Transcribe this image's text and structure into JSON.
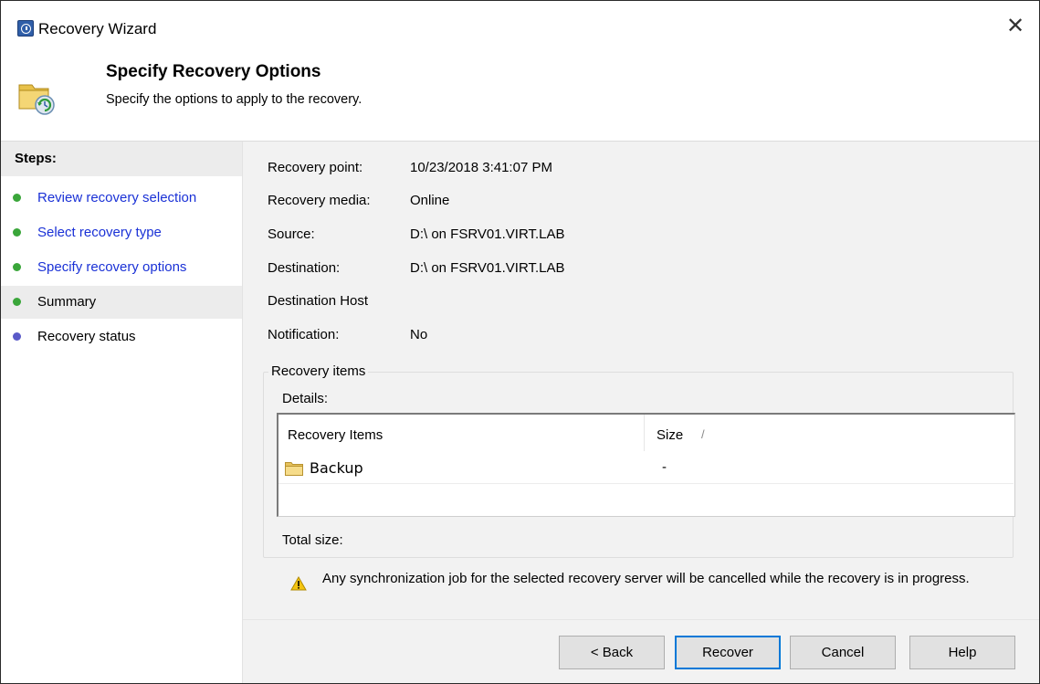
{
  "window": {
    "title": "Recovery Wizard",
    "close_glyph": "✕"
  },
  "header": {
    "title": "Specify Recovery Options",
    "subtitle": "Specify the options to apply to the recovery.",
    "icon": "folder-recovery-icon"
  },
  "steps": {
    "heading": "Steps:",
    "items": [
      {
        "label": "Review recovery selection",
        "state": "completed",
        "dot_color": "#3aa63a",
        "is_link": true
      },
      {
        "label": "Select recovery type",
        "state": "completed",
        "dot_color": "#3aa63a",
        "is_link": true
      },
      {
        "label": "Specify recovery options",
        "state": "completed",
        "dot_color": "#3aa63a",
        "is_link": true
      },
      {
        "label": "Summary",
        "state": "current",
        "dot_color": "#3aa63a",
        "is_link": false
      },
      {
        "label": "Recovery status",
        "state": "pending",
        "dot_color": "#5a5ac8",
        "is_link": false
      }
    ]
  },
  "details": {
    "recovery_point": {
      "label": "Recovery point:",
      "value": "10/23/2018 3:41:07 PM"
    },
    "recovery_media": {
      "label": "Recovery media:",
      "value": "Online"
    },
    "source": {
      "label": "Source:",
      "value": "D:\\ on FSRV01.VIRT.LAB"
    },
    "destination": {
      "label": "Destination:",
      "value": "D:\\ on FSRV01.VIRT.LAB"
    },
    "destination_host": {
      "label": "Destination Host",
      "value": ""
    },
    "notification": {
      "label": "Notification:",
      "value": "No"
    }
  },
  "recovery_items": {
    "group_label": "Recovery items",
    "details_label": "Details:",
    "columns": [
      "Recovery Items",
      "Size"
    ],
    "sort_indicator": "/",
    "rows": [
      {
        "name": "Backup",
        "size": "-",
        "icon": "folder-icon"
      }
    ],
    "total_size_label": "Total size:"
  },
  "warning": {
    "icon": "warning-icon",
    "text": "Any synchronization job for the selected recovery server will be cancelled while the recovery is in progress."
  },
  "buttons": {
    "back": "< Back",
    "recover": "Recover",
    "cancel": "Cancel",
    "help": "Help"
  },
  "colors": {
    "link": "#1a31d6",
    "accent": "#0078d7",
    "panel_bg": "#f2f2f2",
    "step_done": "#3aa63a",
    "step_pending": "#5a5ac8"
  }
}
